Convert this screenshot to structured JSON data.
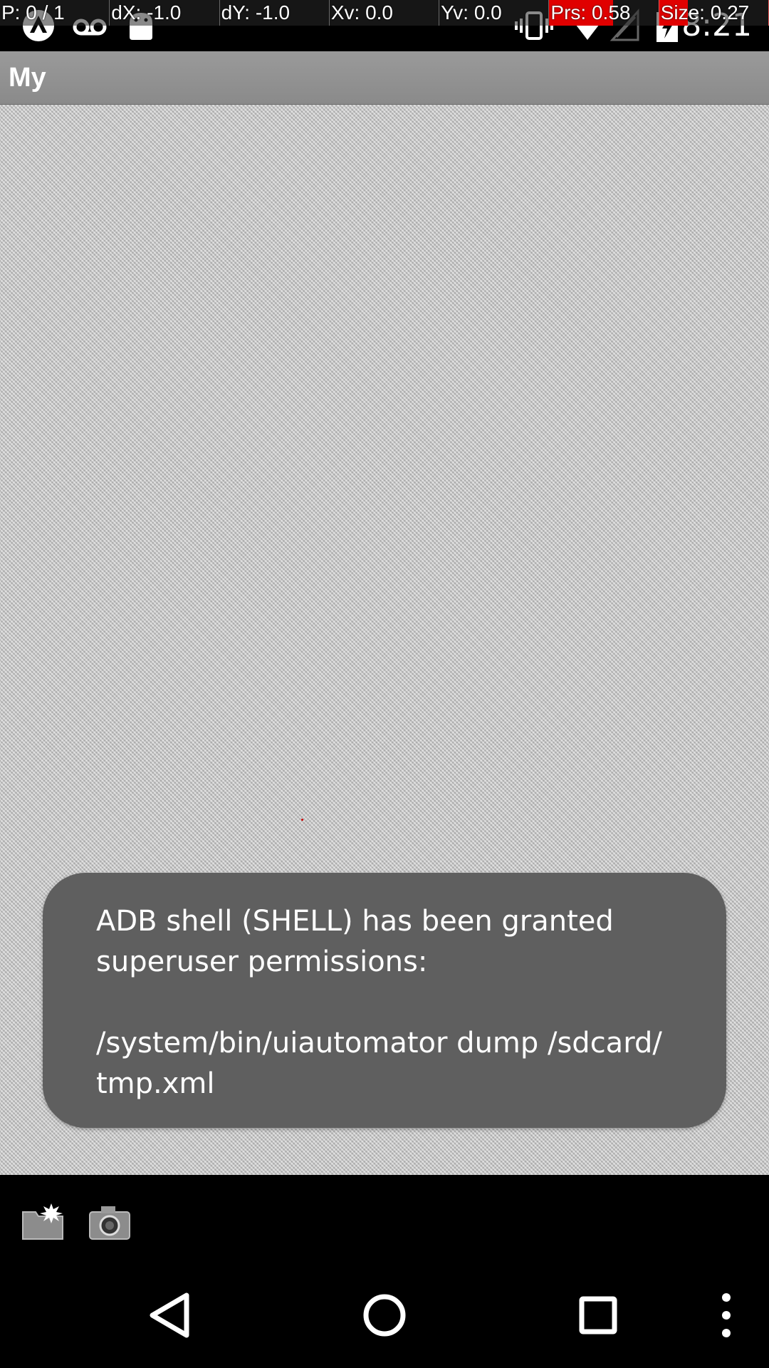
{
  "status_bar": {
    "time": "8:21",
    "icons": [
      "app-notification-icon",
      "voicemail-icon",
      "android-icon",
      "vibrate-icon",
      "wifi-icon",
      "no-signal-icon",
      "battery-charging-icon"
    ]
  },
  "pointer_overlay": {
    "pointers": "P: 0 / 1",
    "dx": "dX: -1.0",
    "dy": "dY: -1.0",
    "xv": "Xv: 0.0",
    "yv": "Yv: 0.0",
    "pressure": "Prs: 0.58",
    "size": "Size: 0.27"
  },
  "action_bar": {
    "title": "My"
  },
  "toast": {
    "line1": "ADB shell (SHELL) has been granted",
    "line2": "superuser permissions:",
    "line3": "/system/bin/uiautomator dump /sdcard/",
    "line4": "tmp.xml"
  },
  "toolbar": {
    "icons": [
      "new-folder-icon",
      "camera-icon"
    ]
  },
  "nav_bar": {
    "buttons": [
      "back-icon",
      "home-icon",
      "recents-icon",
      "overflow-menu-icon"
    ]
  },
  "colors": {
    "toast_bg": "#5f5f5f",
    "action_bar": "#919191",
    "overlay_highlight": "#e00000"
  }
}
